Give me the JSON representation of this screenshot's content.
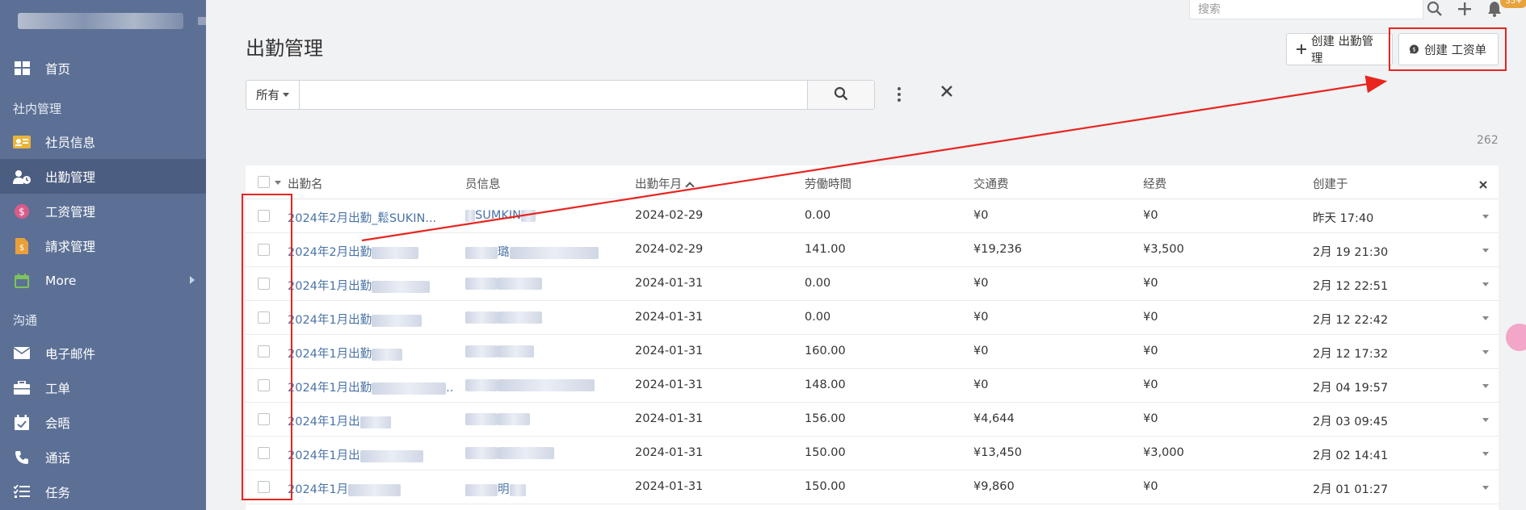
{
  "sidebar": {
    "items": [
      {
        "label": "首页",
        "icon": "dashboard-icon"
      },
      {
        "label": "社员信息",
        "icon": "id-card-icon"
      },
      {
        "label": "出勤管理",
        "icon": "user-clock-icon",
        "active": true
      },
      {
        "label": "工资管理",
        "icon": "money-icon"
      },
      {
        "label": "請求管理",
        "icon": "invoice-icon"
      },
      {
        "label": "More",
        "icon": "calendar-icon"
      },
      {
        "label": "电子邮件",
        "icon": "envelope-icon"
      },
      {
        "label": "工单",
        "icon": "briefcase-icon"
      },
      {
        "label": "会晤",
        "icon": "calendar-check-icon"
      },
      {
        "label": "通话",
        "icon": "phone-icon"
      },
      {
        "label": "任务",
        "icon": "tasks-icon"
      }
    ],
    "sections": {
      "internal": "社内管理",
      "communication": "沟通"
    }
  },
  "topbar": {
    "search_placeholder": "搜索",
    "badge": "35+"
  },
  "page": {
    "title": "出勤管理"
  },
  "actions": {
    "create_attendance": "创建 出勤管理",
    "create_payroll": "创建 工资单"
  },
  "filter": {
    "select_value": "所有",
    "input_value": ""
  },
  "list": {
    "count": "262",
    "columns": [
      "出勤名",
      "员信息",
      "出勤年月",
      "劳働時間",
      "交通费",
      "经费",
      "创建于"
    ],
    "rows": [
      {
        "name": "2024年2月出勤_鬆SU",
        "name_tail": "KIN...",
        "member": "SUMKIN",
        "month": "2024-02-29",
        "hours": "0.00",
        "transport": "¥0",
        "expense": "¥0",
        "created": "昨天 17:40"
      },
      {
        "name": "2024年2月出勤",
        "name_tail": "",
        "member": "璐",
        "month": "2024-02-29",
        "hours": "141.00",
        "transport": "¥19,236",
        "expense": "¥3,500",
        "created": "2月 19 21:30"
      },
      {
        "name": "2024年1月出勤",
        "name_tail": "",
        "member": "",
        "month": "2024-01-31",
        "hours": "0.00",
        "transport": "¥0",
        "expense": "¥0",
        "created": "2月 12 22:51"
      },
      {
        "name": "2024年1月出勤",
        "name_tail": "",
        "member": "",
        "month": "2024-01-31",
        "hours": "0.00",
        "transport": "¥0",
        "expense": "¥0",
        "created": "2月 12 22:42"
      },
      {
        "name": "2024年1月出勤",
        "name_tail": "",
        "member": "",
        "month": "2024-01-31",
        "hours": "160.00",
        "transport": "¥0",
        "expense": "¥0",
        "created": "2月 12 17:32"
      },
      {
        "name": "2024年1月出勤",
        "name_tail": "..",
        "member": "",
        "month": "2024-01-31",
        "hours": "148.00",
        "transport": "¥0",
        "expense": "¥0",
        "created": "2月 04 19:57"
      },
      {
        "name": "2024年1月出",
        "name_tail": "",
        "member": "",
        "month": "2024-01-31",
        "hours": "156.00",
        "transport": "¥4,644",
        "expense": "¥0",
        "created": "2月 03 09:45"
      },
      {
        "name": "2024年1月出",
        "name_tail": "",
        "member": "",
        "month": "2024-01-31",
        "hours": "150.00",
        "transport": "¥13,450",
        "expense": "¥3,000",
        "created": "2月 02 14:41"
      },
      {
        "name": "2024年1月",
        "name_tail": "",
        "member": "明",
        "month": "2024-01-31",
        "hours": "150.00",
        "transport": "¥9,860",
        "expense": "¥0",
        "created": "2月 01 01:27"
      }
    ]
  },
  "colors": {
    "sidebar": "#5c7096",
    "sidebar_active": "#4b5d80",
    "link": "#4a73a6",
    "annotation": "#e8251f"
  }
}
